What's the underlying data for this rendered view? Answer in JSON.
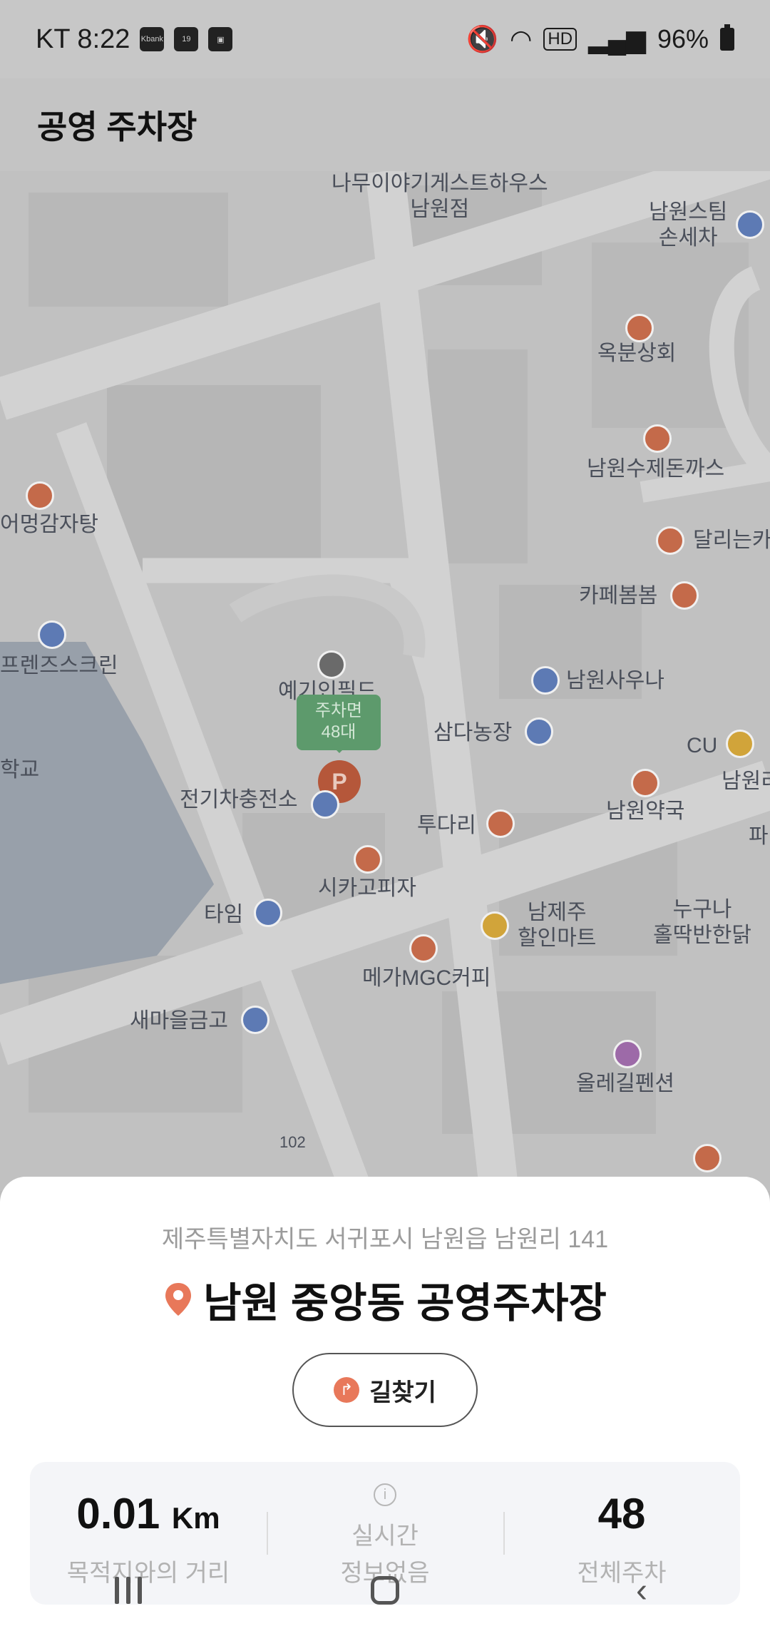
{
  "status_bar": {
    "carrier_time": "KT 8:22",
    "notif_icons": [
      "Kbank",
      "19",
      "gallery-icon"
    ],
    "right_icons": [
      "mute-icon",
      "wifi-icon",
      "HD",
      "signal-icon"
    ],
    "battery": "96%"
  },
  "header": {
    "title": "공영 주차장"
  },
  "map": {
    "pois": {
      "guesthouse": "나무이야기게스트하우스\n남원점",
      "steam": "남원스팀\n손세차",
      "okbun": "옥분상회",
      "sujedon": "남원수제돈까스",
      "dalineun": "달리는카",
      "meong": "어멍감자탕",
      "cafebom": "카페봄봄",
      "friends": "프렌즈스크린",
      "sauna": "남원사우나",
      "yegin": "예기인필드",
      "samda": "삼다농장",
      "cu": "CU",
      "namwon_r": "남원리",
      "ev": "전기차충전소",
      "pharmacy": "남원약국",
      "tudari": "투다리",
      "school": "학교",
      "pizza": "시카고피자",
      "papa": "파",
      "time": "타임",
      "namje": "남제주\n할인마트",
      "nuguna": "누구나\n홀딱반한닭",
      "mega": "메가MGC커피",
      "saemaeul": "새마을금고",
      "olle": "올레길펜션",
      "road102": "102"
    },
    "parking_flag": {
      "line1": "주차면",
      "line2": "48대"
    },
    "parking_pin": "P"
  },
  "sheet": {
    "address": "제주특별자치도 서귀포시 남원읍 남원리 141",
    "place_name": "남원 중앙동 공영주차장",
    "route_button": "길찾기",
    "distance_value": "0.01",
    "distance_unit": "Km",
    "distance_label": "목적지와의 거리",
    "realtime_line1": "실시간",
    "realtime_line2": "정보없음",
    "total_value": "48",
    "total_label": "전체주차"
  },
  "colors": {
    "accent": "#e8785a",
    "parking_green": "#5d9a6c"
  }
}
